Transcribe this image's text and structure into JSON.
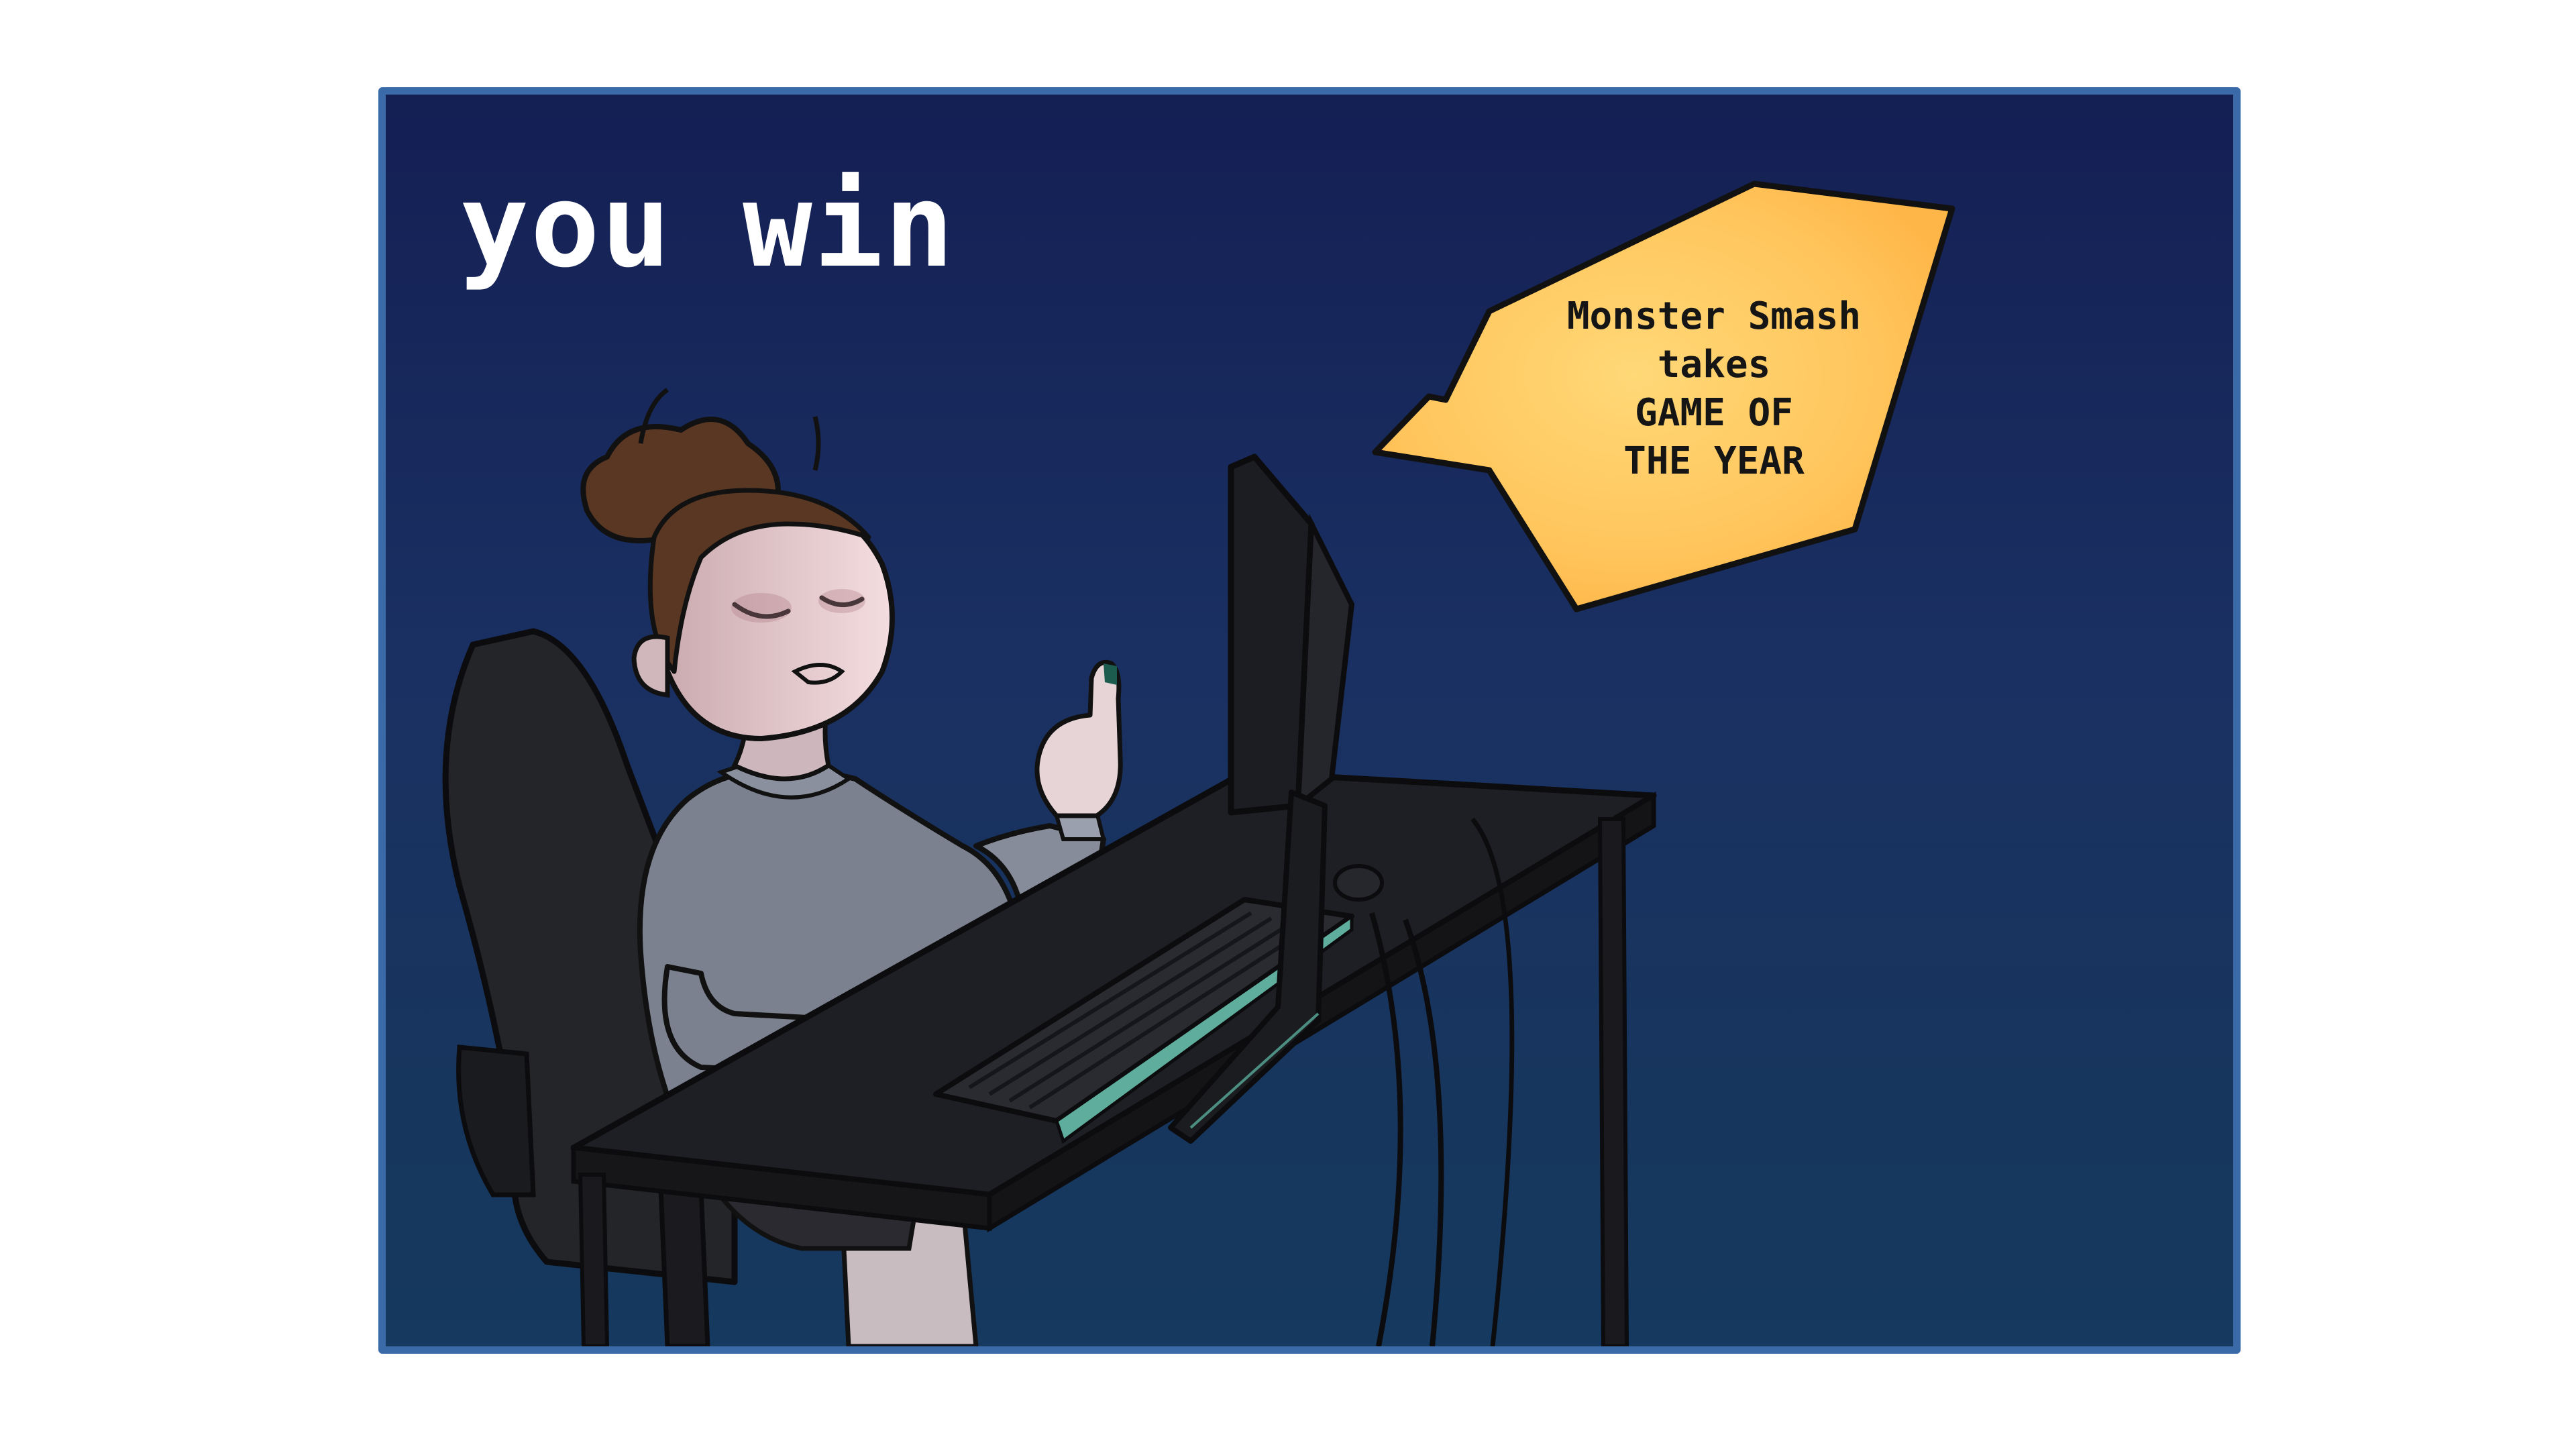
{
  "panel": {
    "title": "you win"
  },
  "speech_bubble": {
    "lines": [
      "Monster Smash",
      "takes",
      "GAME OF",
      "THE YEAR"
    ]
  },
  "colors": {
    "panel_border": "#3a6aa8",
    "background_top": "#141f54",
    "background_bottom": "#15395f",
    "bubble_fill": "#ffc761",
    "bubble_fill_light": "#ffd374",
    "sweater": "#7c8290",
    "hair": "#5a3722",
    "desk": "#1e1f24"
  },
  "icons": [
    "speech-bubble",
    "gamer-character",
    "computer-monitor",
    "keyboard",
    "gaming-chair",
    "desk"
  ]
}
